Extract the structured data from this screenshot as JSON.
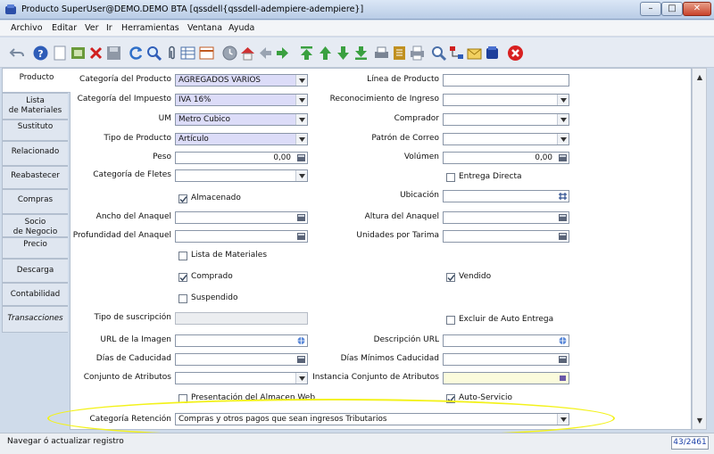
{
  "window": {
    "title": "Producto  SuperUser@DEMO.DEMO BTA [qssdell{qssdell-adempiere-adempiere}]",
    "minimize_glyph": "–",
    "maximize_glyph": "□",
    "close_glyph": "✕"
  },
  "menu": [
    "Archivo",
    "Editar",
    "Ver",
    "Ir",
    "Herramientas",
    "Ventana",
    "Ayuda"
  ],
  "toolbar": {
    "icons": [
      "undo-icon",
      "help-icon",
      "new-record-icon",
      "copy-record-icon",
      "delete-icon",
      "save-icon",
      "refresh-icon",
      "find-icon",
      "attachment-icon",
      "grid-toggle-icon",
      "history-icon",
      "home-icon",
      "back-icon",
      "forward-icon",
      "first-record-icon",
      "previous-record-icon",
      "next-record-icon",
      "last-record-icon",
      "report-icon",
      "archive-icon",
      "print-icon",
      "zoom-across-icon",
      "workflow-icon",
      "request-icon",
      "product-info-icon",
      "close-window-icon"
    ]
  },
  "tabs": [
    {
      "label": "Producto",
      "active": true
    },
    {
      "label": "Lista\nde Materiales"
    },
    {
      "label": "Sustituto"
    },
    {
      "label": "Relacionado"
    },
    {
      "label": "Reabastecer"
    },
    {
      "label": "Compras"
    },
    {
      "label": "Socio\nde Negocio"
    },
    {
      "label": "Precio"
    },
    {
      "label": "Descarga"
    },
    {
      "label": "Contabilidad"
    },
    {
      "label": "Transacciones",
      "italic": true
    }
  ],
  "form": {
    "product_category_label": "Categoría del Producto",
    "product_category_value": "AGREGADOS VARIOS",
    "tax_category_label": "Categoría del Impuesto",
    "tax_category_value": "IVA 16%",
    "uom_label": "UM",
    "uom_value": "Metro Cubico",
    "product_type_label": "Tipo de Producto",
    "product_type_value": "Artículo",
    "weight_label": "Peso",
    "weight_value": "0,00",
    "freight_category_label": "Categoría de Fletes",
    "stocked_label": "Almacenado",
    "stocked_checked": true,
    "shelf_width_label": "Ancho del Anaquel",
    "shelf_depth_label": "Profundidad del Anaquel",
    "bom_label": "Lista de Materiales",
    "bom_checked": false,
    "purchased_label": "Comprado",
    "purchased_checked": true,
    "discontinued_label": "Suspendido",
    "discontinued_checked": false,
    "subscription_type_label": "Tipo de suscripción",
    "image_url_label": "URL de la Imagen",
    "guarantee_days_label": "Días de Caducidad",
    "attribute_set_label": "Conjunto de Atributos",
    "web_store_label": "Presentación del Almacen Web",
    "web_store_checked": false,
    "withholding_category_label": "Categoría Retención",
    "withholding_category_value": "Compras y otros pagos que sean ingresos Tributarios",
    "product_line_label": "Línea de Producto",
    "revenue_recognition_label": "Reconocimiento de Ingreso",
    "buyer_label": "Comprador",
    "mail_template_label": "Patrón de Correo",
    "volume_label": "Volúmen",
    "volume_value": "0,00",
    "drop_ship_label": "Entrega Directa",
    "drop_ship_checked": false,
    "locator_label": "Ubicación",
    "shelf_height_label": "Altura del Anaquel",
    "units_per_pallet_label": "Unidades por Tarima",
    "sold_label": "Vendido",
    "sold_checked": true,
    "exclude_auto_delivery_label": "Excluir de Auto Entrega",
    "exclude_auto_delivery_checked": false,
    "description_url_label": "Descripción URL",
    "min_guarantee_days_label": "Días Mínimos Caducidad",
    "attribute_instance_label": "Instancia Conjunto de Atributos",
    "self_service_label": "Auto-Servicio",
    "self_service_checked": true
  },
  "status": {
    "message": "Navegar ó actualizar registro",
    "record_count": "43/2461"
  },
  "colors": {
    "mandatory_field": "#dcdcf8",
    "highlight_ring": "#f3f21a",
    "record_count_text": "#1a3fa8"
  }
}
